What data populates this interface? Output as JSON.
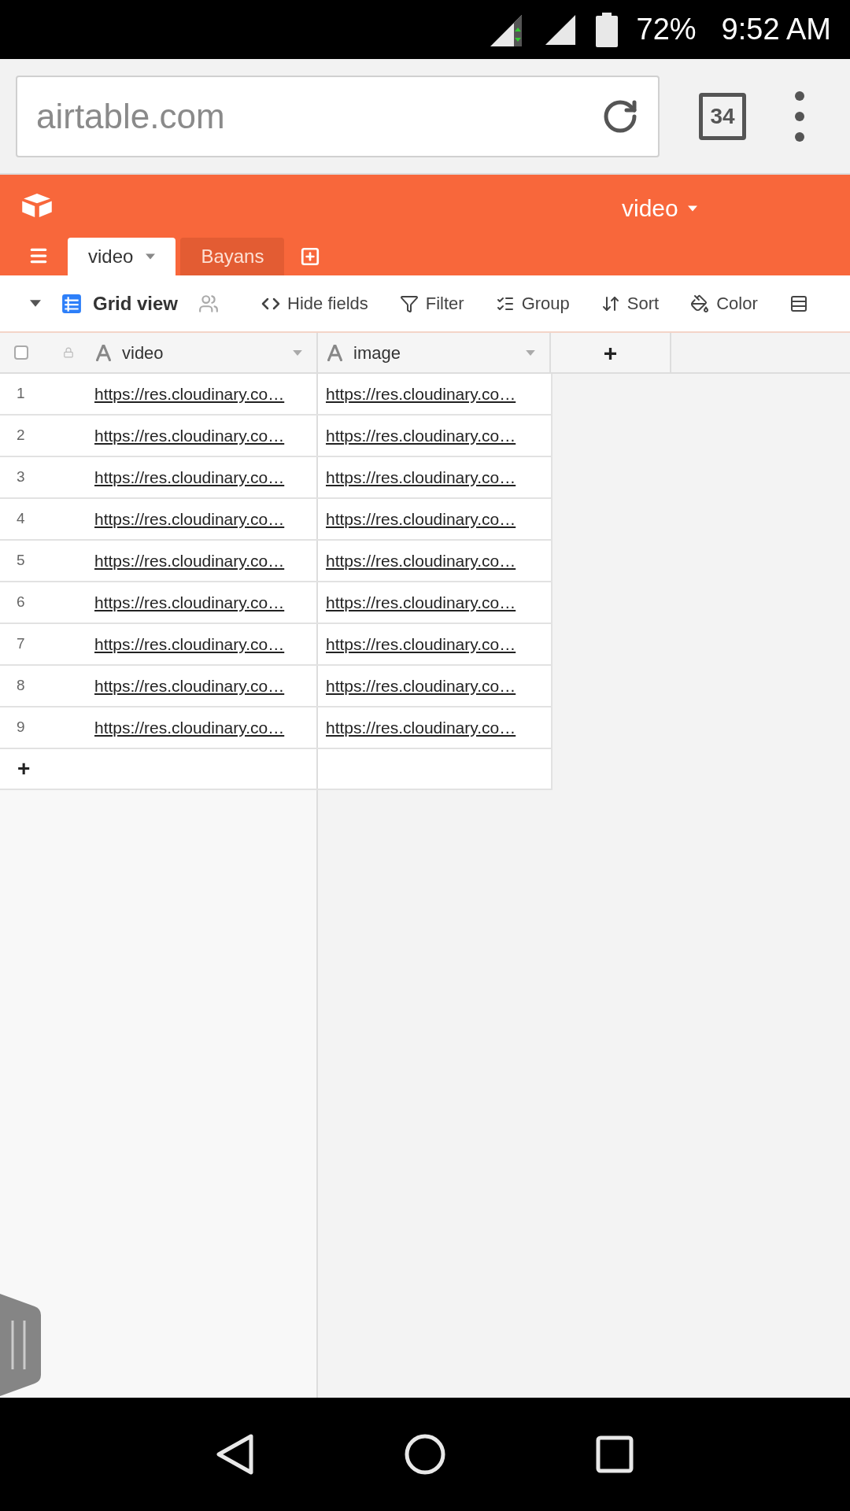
{
  "status_bar": {
    "battery": "72%",
    "time": "9:52 AM"
  },
  "browser": {
    "url": "airtable.com",
    "tab_count": "34"
  },
  "base": {
    "title": "video"
  },
  "table_tabs": [
    {
      "label": "video",
      "selected": true
    },
    {
      "label": "Bayans",
      "selected": false
    }
  ],
  "toolbar": {
    "view": "Grid view",
    "buttons": [
      {
        "kind": "hide",
        "label": "Hide fields"
      },
      {
        "kind": "filter",
        "label": "Filter"
      },
      {
        "kind": "group",
        "label": "Group"
      },
      {
        "kind": "sort",
        "label": "Sort"
      },
      {
        "kind": "color",
        "label": "Color"
      }
    ]
  },
  "grid": {
    "select_all": {
      "checked": false
    },
    "columns": [
      {
        "name": "video"
      },
      {
        "name": "image"
      }
    ],
    "add_column": "+",
    "rows": [
      {
        "number": "1",
        "cells": [
          "https://res.cloudinary.co…",
          "https://res.cloudinary.co…"
        ]
      },
      {
        "number": "2",
        "cells": [
          "https://res.cloudinary.co…",
          "https://res.cloudinary.co…"
        ]
      },
      {
        "number": "3",
        "cells": [
          "https://res.cloudinary.co…",
          "https://res.cloudinary.co…"
        ]
      },
      {
        "number": "4",
        "cells": [
          "https://res.cloudinary.co…",
          "https://res.cloudinary.co…"
        ]
      },
      {
        "number": "5",
        "cells": [
          "https://res.cloudinary.co…",
          "https://res.cloudinary.co…"
        ]
      },
      {
        "number": "6",
        "cells": [
          "https://res.cloudinary.co…",
          "https://res.cloudinary.co…"
        ]
      },
      {
        "number": "7",
        "cells": [
          "https://res.cloudinary.co…",
          "https://res.cloudinary.co…"
        ]
      },
      {
        "number": "8",
        "cells": [
          "https://res.cloudinary.co…",
          "https://res.cloudinary.co…"
        ]
      },
      {
        "number": "9",
        "cells": [
          "https://res.cloudinary.co…",
          "https://res.cloudinary.co…"
        ]
      }
    ],
    "add_row": "+"
  }
}
